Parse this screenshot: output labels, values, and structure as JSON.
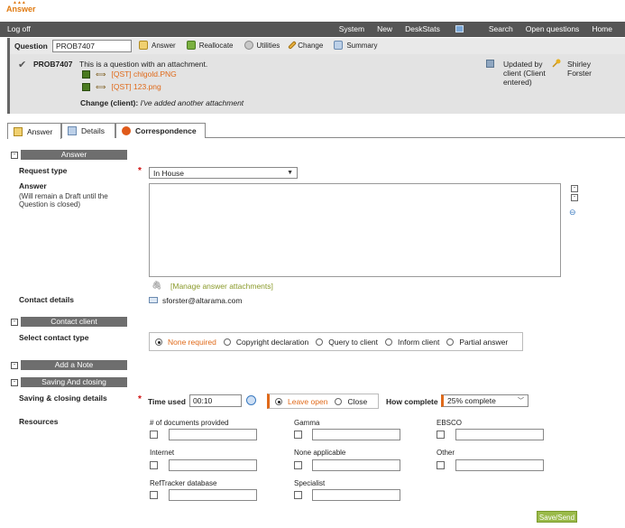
{
  "logo": {
    "text": "Answer"
  },
  "topbar": {
    "logoff": "Log off",
    "nav": [
      "System",
      "New",
      "DeskStats",
      "Search",
      "Open questions",
      "Home"
    ]
  },
  "question_bar": {
    "label": "Question",
    "value": "PROB7407",
    "tools": [
      "Answer",
      "Reallocate",
      "Utilities",
      "Change",
      "Summary"
    ]
  },
  "question_info": {
    "id": "PROB7407",
    "text": "This is a question with an attachment.",
    "attachments": [
      "[QST] chlgold.PNG",
      "[QST] 123.png"
    ],
    "change_label": "Change (client):",
    "change_text": "I've added another attachment",
    "updated_by": "Updated by client (Client entered)",
    "user": "Shirley Forster"
  },
  "tabs": [
    "Answer",
    "Details",
    "Correspondence"
  ],
  "answer_section": {
    "header": "Answer",
    "request_type_label": "Request type",
    "request_type_value": "In House",
    "answer_label": "Answer",
    "answer_note": "(Will remain a Draft until the Question is closed)",
    "manage_attachments": "[Manage answer attachments]",
    "contact_details_label": "Contact details",
    "contact_email": "sforster@altarama.com"
  },
  "contact_client": {
    "header": "Contact client",
    "label": "Select contact type",
    "options": [
      "None required",
      "Copyright declaration",
      "Query to client",
      "Inform client",
      "Partial answer"
    ],
    "selected": 0
  },
  "add_note": {
    "header": "Add a Note"
  },
  "saving": {
    "header": "Saving And closing",
    "label": "Saving & closing details",
    "time_used_label": "Time used",
    "time_used_value": "00:10",
    "leave_open": "Leave open",
    "close": "Close",
    "how_complete_label": "How complete",
    "how_complete_value": "25% complete"
  },
  "resources": {
    "label": "Resources",
    "items": [
      "# of documents provided",
      "Gamma",
      "EBSCO",
      "Internet",
      "None applicable",
      "Other",
      "RefTracker database",
      "Specialist"
    ]
  },
  "save_send": "Save/Send",
  "colors": {
    "topbar": "#555555",
    "accent_orange": "#e06a1a",
    "section_bar": "#6e6e6e",
    "save_green": "#9aba4a"
  }
}
